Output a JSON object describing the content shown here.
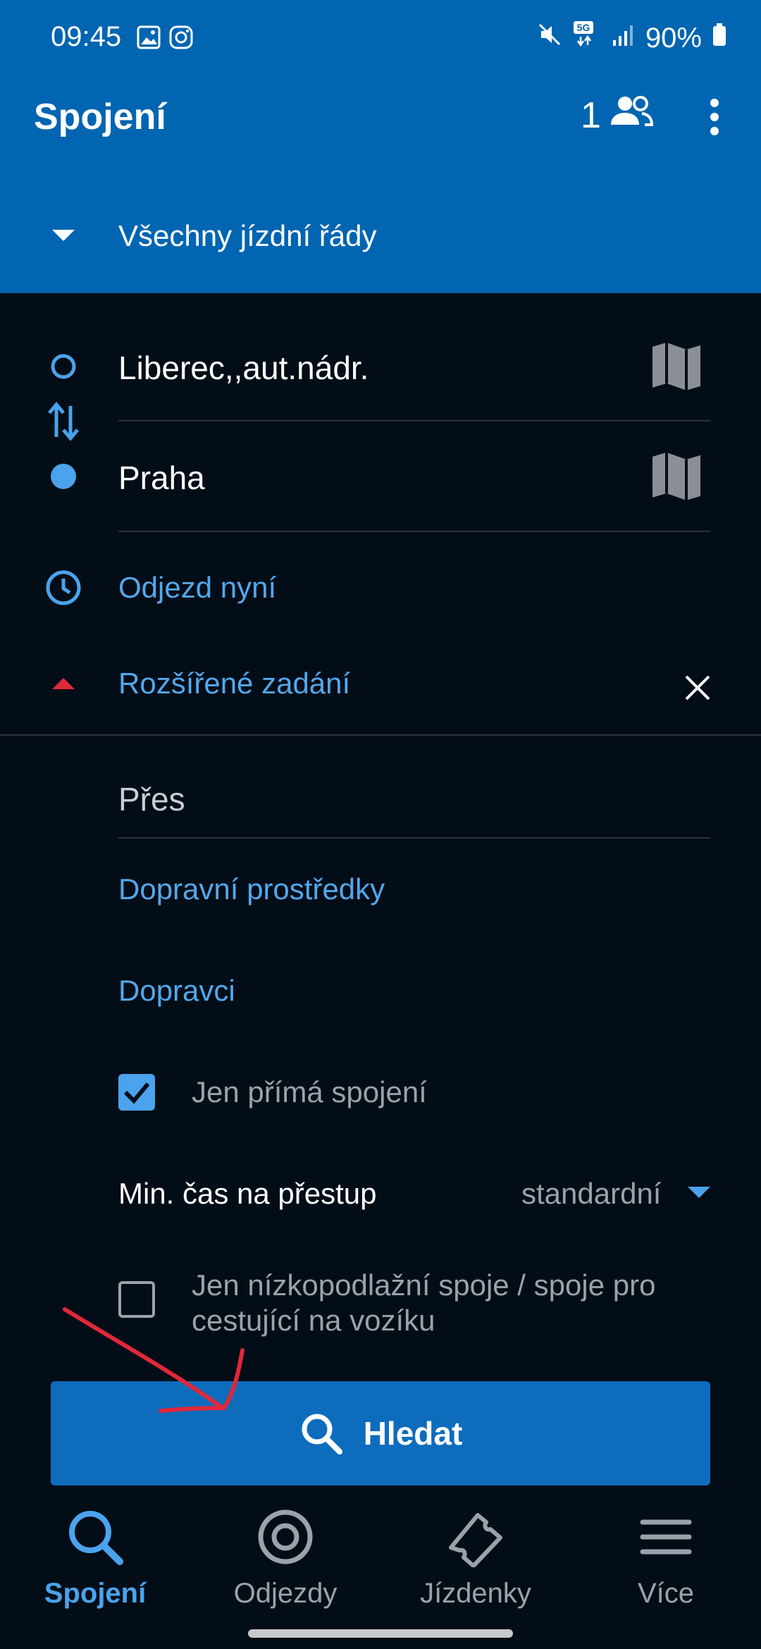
{
  "status_bar": {
    "time": "09:45",
    "battery": "90%"
  },
  "app_bar": {
    "title": "Spojení",
    "passenger_count": "1"
  },
  "timetable_selector": {
    "label": "Všechny jízdní řády"
  },
  "route": {
    "from": "Liberec,,aut.nádr.",
    "to": "Praha",
    "departure": "Odjezd nyní"
  },
  "advanced": {
    "toggle_label": "Rozšířené zadání",
    "via_placeholder": "Přes",
    "transport_modes_label": "Dopravní prostředky",
    "carriers_label": "Dopravci",
    "direct_only": {
      "label": "Jen přímá spojení",
      "checked": true
    },
    "min_transfer": {
      "label": "Min. čas na přestup",
      "value": "standardní"
    },
    "low_floor": {
      "label_line1": "Jen nízkopodlažní spoje / spoje pro",
      "label_line2": "cestující na vozíku",
      "checked": false
    }
  },
  "search_button": {
    "label": "Hledat"
  },
  "bottom_nav": {
    "items": [
      {
        "label": "Spojení",
        "icon": "search-icon",
        "active": true
      },
      {
        "label": "Odjezdy",
        "icon": "target-icon",
        "active": false
      },
      {
        "label": "Jízdenky",
        "icon": "ticket-icon",
        "active": false
      },
      {
        "label": "Více",
        "icon": "menu-icon",
        "active": false
      }
    ]
  },
  "colors": {
    "app_bar": "#0165b1",
    "background": "#030d17",
    "accent": "#52a8ec",
    "button": "#0e6cbd",
    "collapse_indicator": "#e0283a",
    "annotation_arrow": "#e0283a"
  }
}
